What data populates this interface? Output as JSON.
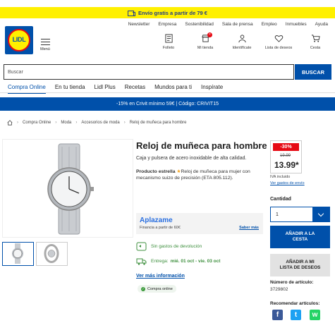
{
  "promo": {
    "text": "Envío gratis a partir de 79 €"
  },
  "util_links": [
    "Newsletter",
    "Empresa",
    "Sostenibilidad",
    "Sala de prensa",
    "Empleo",
    "Inmuebles",
    "Ayuda"
  ],
  "header": {
    "logo_text": "LIDL",
    "menu_label": "Menú",
    "icons": [
      {
        "label": "Folleto",
        "icon": "folleto-icon"
      },
      {
        "label": "Mi tienda",
        "icon": "store-icon"
      },
      {
        "label": "Identifícate",
        "icon": "user-icon"
      },
      {
        "label": "Lista de deseos",
        "icon": "heart-icon"
      },
      {
        "label": "Cesta",
        "icon": "cart-icon"
      }
    ]
  },
  "search": {
    "placeholder": "Buscar",
    "button": "BUSCAR"
  },
  "nav": [
    "Compra Online",
    "En tu tienda",
    "Lidl Plus",
    "Recetas",
    "Mundos para ti",
    "Inspírate"
  ],
  "coupon": {
    "text": "-15% en Crivit mínimo 59€ | Código: CRIVIT15"
  },
  "breadcrumb": [
    "Compra Online",
    "Moda",
    "Accesorios de moda",
    "Reloj de muñeca para hombre"
  ],
  "product": {
    "title": "Reloj de muñeca para hombre",
    "subtitle": "Caja y pulsera de acero inoxidable de alta calidad.",
    "estrella_label": "Producto estrella",
    "estrella_text": "Reloj de muñeca para mujer con mecanismo suizo de precisión (ETA 805.112).",
    "aplazame_brand": "Aplazame",
    "aplazame_fin": "Financia a partir de 60€",
    "aplazame_more": "Saber más",
    "devolucion": "Sin gastos de devolución",
    "entrega_label": "Entrega:",
    "entrega_dates": "mié. 01 oct - vie. 03 oct",
    "ver_mas": "Ver más información",
    "online_badge": "Compra online"
  },
  "price": {
    "discount": "-30%",
    "old": "19.99",
    "current": "13.99*",
    "iva": "IVA incluido",
    "gastos": "Ver gastos de envío"
  },
  "buy": {
    "qty_label": "Cantidad",
    "qty_value": "1",
    "add_cart_l1": "AÑADIR A LA",
    "add_cart_l2": "CESTA",
    "add_wish_l1": "AÑADIR A MI",
    "add_wish_l2": "LISTA DE DESEOS",
    "art_label": "Número de artículo:",
    "art_number": "3729802",
    "recommend": "Recomendar artículos:"
  },
  "colors": {
    "lidl_blue": "#0050aa",
    "lidl_yellow": "#fff000",
    "lidl_red": "#e60a14",
    "green": "#3d8f3d"
  },
  "social": [
    {
      "name": "facebook",
      "glyph": "f",
      "color": "#3b5998"
    },
    {
      "name": "twitter",
      "glyph": "t",
      "color": "#1da1f2"
    },
    {
      "name": "whatsapp",
      "glyph": "w",
      "color": "#25d366"
    }
  ]
}
